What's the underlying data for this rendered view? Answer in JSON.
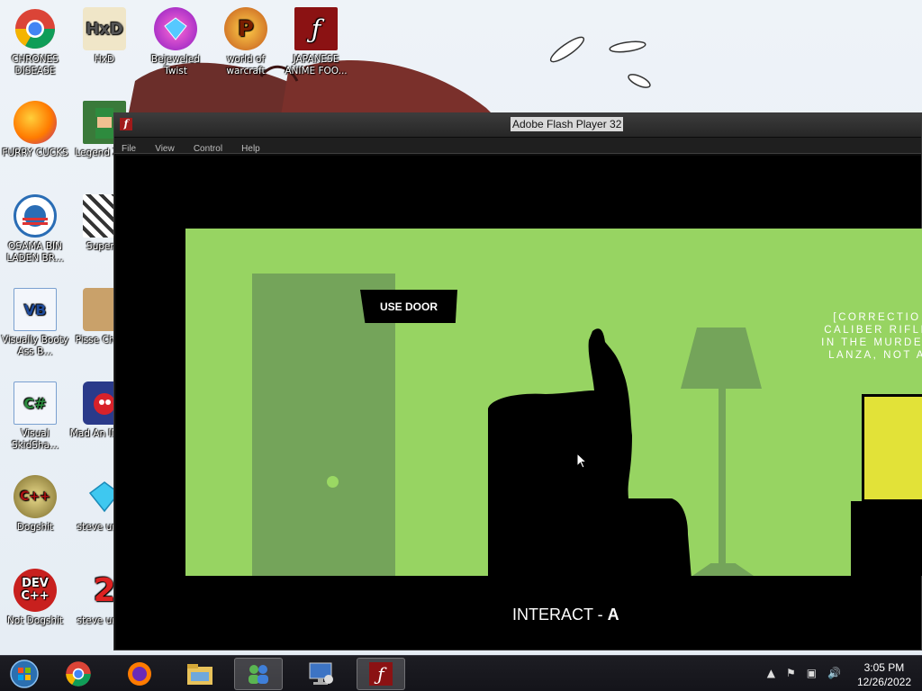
{
  "desktop": {
    "icons": [
      {
        "label": "CHRONES DISEASE",
        "icon": "chrome-icon"
      },
      {
        "label": "HxD",
        "icon": "hxd-icon"
      },
      {
        "label": "Bejeweled Twist",
        "icon": "bejeweled-icon"
      },
      {
        "label": "world of warcraft",
        "icon": "wow-icon"
      },
      {
        "label": "JAPANESE ANIME FOO...",
        "icon": "flash-icon"
      },
      {
        "label": "FURRY CUCKS",
        "icon": "firefox-icon"
      },
      {
        "label": "Legend Zeld",
        "icon": "zelda-icon"
      },
      {
        "label": "OSAMA BIN LADEN BR...",
        "icon": "obama-logo-icon"
      },
      {
        "label": "Super F",
        "icon": "pixel-icon"
      },
      {
        "label": "Visually Booty Ass B...",
        "icon": "vb-icon"
      },
      {
        "label": "Pisse Chicke",
        "icon": "chicken-icon"
      },
      {
        "label": "Visual SkidSha...",
        "icon": "csharp-icon"
      },
      {
        "label": "Mad An IN SPA",
        "icon": "angry-birds-icon"
      },
      {
        "label": "Dogshit",
        "icon": "cpp-icon"
      },
      {
        "label": "steve unive",
        "icon": "diamond-icon"
      },
      {
        "label": "Not Dogshit",
        "icon": "devcpp-icon"
      },
      {
        "label": "steve unive",
        "icon": "steve2-icon"
      }
    ]
  },
  "window": {
    "title": "Adobe Flash Player 32",
    "menu": [
      "File",
      "View",
      "Control",
      "Help"
    ]
  },
  "game": {
    "use_door_label": "USE DOOR",
    "news_lines": [
      "[CORRECTIO",
      "CALIBER RIFLE",
      "IN THE MURDER",
      "LANZA, NOT A"
    ],
    "interact_prefix": "INTERACT - ",
    "interact_key": "A"
  },
  "taskbar": {
    "time": "3:05 PM",
    "date": "12/26/2022"
  },
  "colors": {
    "scene_bg": "#97d462",
    "scene_dark": "#74a45a",
    "tv_screen": "#e2e238"
  }
}
